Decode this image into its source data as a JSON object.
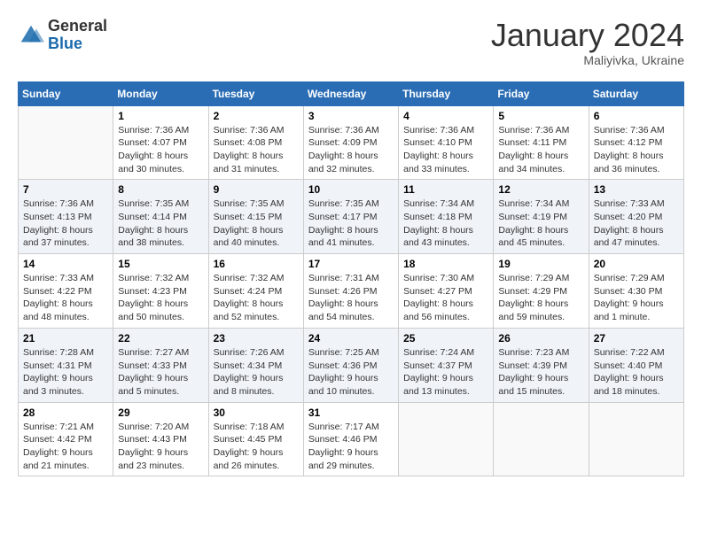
{
  "header": {
    "logo_general": "General",
    "logo_blue": "Blue",
    "month_title": "January 2024",
    "location": "Maliyivka, Ukraine"
  },
  "weekdays": [
    "Sunday",
    "Monday",
    "Tuesday",
    "Wednesday",
    "Thursday",
    "Friday",
    "Saturday"
  ],
  "weeks": [
    [
      {
        "day": "",
        "sunrise": "",
        "sunset": "",
        "daylight": ""
      },
      {
        "day": "1",
        "sunrise": "Sunrise: 7:36 AM",
        "sunset": "Sunset: 4:07 PM",
        "daylight": "Daylight: 8 hours and 30 minutes."
      },
      {
        "day": "2",
        "sunrise": "Sunrise: 7:36 AM",
        "sunset": "Sunset: 4:08 PM",
        "daylight": "Daylight: 8 hours and 31 minutes."
      },
      {
        "day": "3",
        "sunrise": "Sunrise: 7:36 AM",
        "sunset": "Sunset: 4:09 PM",
        "daylight": "Daylight: 8 hours and 32 minutes."
      },
      {
        "day": "4",
        "sunrise": "Sunrise: 7:36 AM",
        "sunset": "Sunset: 4:10 PM",
        "daylight": "Daylight: 8 hours and 33 minutes."
      },
      {
        "day": "5",
        "sunrise": "Sunrise: 7:36 AM",
        "sunset": "Sunset: 4:11 PM",
        "daylight": "Daylight: 8 hours and 34 minutes."
      },
      {
        "day": "6",
        "sunrise": "Sunrise: 7:36 AM",
        "sunset": "Sunset: 4:12 PM",
        "daylight": "Daylight: 8 hours and 36 minutes."
      }
    ],
    [
      {
        "day": "7",
        "sunrise": "Sunrise: 7:36 AM",
        "sunset": "Sunset: 4:13 PM",
        "daylight": "Daylight: 8 hours and 37 minutes."
      },
      {
        "day": "8",
        "sunrise": "Sunrise: 7:35 AM",
        "sunset": "Sunset: 4:14 PM",
        "daylight": "Daylight: 8 hours and 38 minutes."
      },
      {
        "day": "9",
        "sunrise": "Sunrise: 7:35 AM",
        "sunset": "Sunset: 4:15 PM",
        "daylight": "Daylight: 8 hours and 40 minutes."
      },
      {
        "day": "10",
        "sunrise": "Sunrise: 7:35 AM",
        "sunset": "Sunset: 4:17 PM",
        "daylight": "Daylight: 8 hours and 41 minutes."
      },
      {
        "day": "11",
        "sunrise": "Sunrise: 7:34 AM",
        "sunset": "Sunset: 4:18 PM",
        "daylight": "Daylight: 8 hours and 43 minutes."
      },
      {
        "day": "12",
        "sunrise": "Sunrise: 7:34 AM",
        "sunset": "Sunset: 4:19 PM",
        "daylight": "Daylight: 8 hours and 45 minutes."
      },
      {
        "day": "13",
        "sunrise": "Sunrise: 7:33 AM",
        "sunset": "Sunset: 4:20 PM",
        "daylight": "Daylight: 8 hours and 47 minutes."
      }
    ],
    [
      {
        "day": "14",
        "sunrise": "Sunrise: 7:33 AM",
        "sunset": "Sunset: 4:22 PM",
        "daylight": "Daylight: 8 hours and 48 minutes."
      },
      {
        "day": "15",
        "sunrise": "Sunrise: 7:32 AM",
        "sunset": "Sunset: 4:23 PM",
        "daylight": "Daylight: 8 hours and 50 minutes."
      },
      {
        "day": "16",
        "sunrise": "Sunrise: 7:32 AM",
        "sunset": "Sunset: 4:24 PM",
        "daylight": "Daylight: 8 hours and 52 minutes."
      },
      {
        "day": "17",
        "sunrise": "Sunrise: 7:31 AM",
        "sunset": "Sunset: 4:26 PM",
        "daylight": "Daylight: 8 hours and 54 minutes."
      },
      {
        "day": "18",
        "sunrise": "Sunrise: 7:30 AM",
        "sunset": "Sunset: 4:27 PM",
        "daylight": "Daylight: 8 hours and 56 minutes."
      },
      {
        "day": "19",
        "sunrise": "Sunrise: 7:29 AM",
        "sunset": "Sunset: 4:29 PM",
        "daylight": "Daylight: 8 hours and 59 minutes."
      },
      {
        "day": "20",
        "sunrise": "Sunrise: 7:29 AM",
        "sunset": "Sunset: 4:30 PM",
        "daylight": "Daylight: 9 hours and 1 minute."
      }
    ],
    [
      {
        "day": "21",
        "sunrise": "Sunrise: 7:28 AM",
        "sunset": "Sunset: 4:31 PM",
        "daylight": "Daylight: 9 hours and 3 minutes."
      },
      {
        "day": "22",
        "sunrise": "Sunrise: 7:27 AM",
        "sunset": "Sunset: 4:33 PM",
        "daylight": "Daylight: 9 hours and 5 minutes."
      },
      {
        "day": "23",
        "sunrise": "Sunrise: 7:26 AM",
        "sunset": "Sunset: 4:34 PM",
        "daylight": "Daylight: 9 hours and 8 minutes."
      },
      {
        "day": "24",
        "sunrise": "Sunrise: 7:25 AM",
        "sunset": "Sunset: 4:36 PM",
        "daylight": "Daylight: 9 hours and 10 minutes."
      },
      {
        "day": "25",
        "sunrise": "Sunrise: 7:24 AM",
        "sunset": "Sunset: 4:37 PM",
        "daylight": "Daylight: 9 hours and 13 minutes."
      },
      {
        "day": "26",
        "sunrise": "Sunrise: 7:23 AM",
        "sunset": "Sunset: 4:39 PM",
        "daylight": "Daylight: 9 hours and 15 minutes."
      },
      {
        "day": "27",
        "sunrise": "Sunrise: 7:22 AM",
        "sunset": "Sunset: 4:40 PM",
        "daylight": "Daylight: 9 hours and 18 minutes."
      }
    ],
    [
      {
        "day": "28",
        "sunrise": "Sunrise: 7:21 AM",
        "sunset": "Sunset: 4:42 PM",
        "daylight": "Daylight: 9 hours and 21 minutes."
      },
      {
        "day": "29",
        "sunrise": "Sunrise: 7:20 AM",
        "sunset": "Sunset: 4:43 PM",
        "daylight": "Daylight: 9 hours and 23 minutes."
      },
      {
        "day": "30",
        "sunrise": "Sunrise: 7:18 AM",
        "sunset": "Sunset: 4:45 PM",
        "daylight": "Daylight: 9 hours and 26 minutes."
      },
      {
        "day": "31",
        "sunrise": "Sunrise: 7:17 AM",
        "sunset": "Sunset: 4:46 PM",
        "daylight": "Daylight: 9 hours and 29 minutes."
      },
      {
        "day": "",
        "sunrise": "",
        "sunset": "",
        "daylight": ""
      },
      {
        "day": "",
        "sunrise": "",
        "sunset": "",
        "daylight": ""
      },
      {
        "day": "",
        "sunrise": "",
        "sunset": "",
        "daylight": ""
      }
    ]
  ]
}
